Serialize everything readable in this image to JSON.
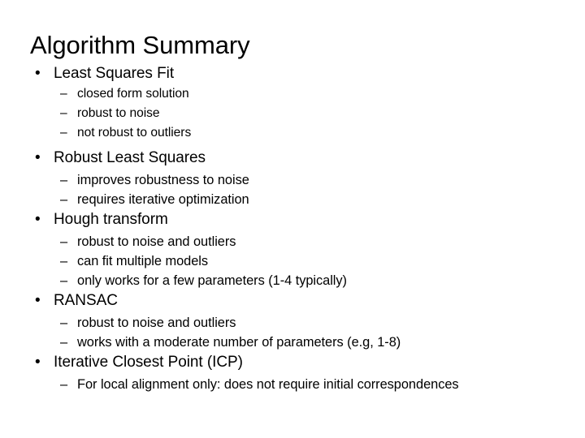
{
  "slide": {
    "title": "Algorithm Summary",
    "background_color": "#ffffff",
    "text_color": "#000000",
    "bullet_glyph": "•",
    "dash_glyph": "–",
    "sections": [
      {
        "heading": "Least Squares Fit",
        "items": [
          "closed form solution",
          "robust to noise",
          "not robust to outliers"
        ]
      },
      {
        "heading": "Robust Least Squares",
        "items": [
          "improves robustness to noise",
          "requires iterative optimization"
        ]
      },
      {
        "heading": "Hough transform",
        "items": [
          "robust to noise and outliers",
          "can fit multiple models",
          "only works for a few parameters (1-4 typically)"
        ]
      },
      {
        "heading": "RANSAC",
        "items": [
          "robust to noise and outliers",
          "works with a moderate number of parameters (e.g, 1-8)"
        ]
      },
      {
        "heading": "Iterative Closest Point (ICP)",
        "items": [
          "For local alignment only: does not require initial correspondences"
        ]
      }
    ]
  }
}
